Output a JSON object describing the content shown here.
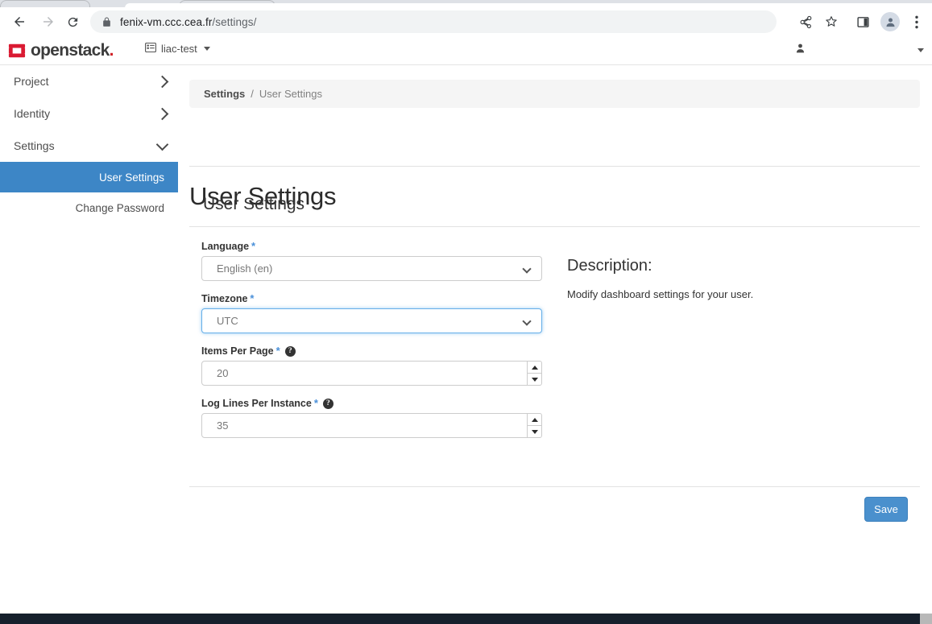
{
  "browser": {
    "url_domain": "fenix-vm.ccc.cea.fr",
    "url_path": "/settings/",
    "back_icon": "back-arrow-icon",
    "forward_icon": "forward-arrow-icon",
    "reload_icon": "reload-icon",
    "lock_icon": "lock-icon",
    "share_icon": "share-icon",
    "bookmark_icon": "star-icon",
    "sidepanel_icon": "side-panel-icon",
    "profile_icon": "profile-avatar-icon",
    "menu_icon": "three-dot-menu-icon"
  },
  "header": {
    "logo_text": "openstack",
    "logo_dot": ".",
    "project_name": "liac-test",
    "project_icon": "project-list-icon",
    "user_icon": "user-avatar-icon",
    "user_name": ""
  },
  "sidebar": {
    "groups": [
      {
        "label": "Project",
        "state": "collapsed",
        "icon": "chevron-right-icon"
      },
      {
        "label": "Identity",
        "state": "collapsed",
        "icon": "chevron-right-icon"
      },
      {
        "label": "Settings",
        "state": "expanded",
        "icon": "chevron-down-icon"
      }
    ],
    "items": [
      {
        "label": "User Settings",
        "active": true
      },
      {
        "label": "Change Password",
        "active": false
      }
    ]
  },
  "breadcrumb": {
    "parent": "Settings",
    "separator": "/",
    "current": "User Settings"
  },
  "page": {
    "title": "User Settings",
    "panel_title": "User Settings"
  },
  "form": {
    "fields": [
      {
        "label": "Language",
        "required_marker": "*",
        "type": "select",
        "value": "English (en)",
        "has_help": false,
        "focused": false,
        "caret_icon": "chevron-down-icon"
      },
      {
        "label": "Timezone",
        "required_marker": "*",
        "type": "select",
        "value": "UTC",
        "has_help": false,
        "focused": true,
        "caret_icon": "chevron-down-icon"
      },
      {
        "label": "Items Per Page",
        "required_marker": "*",
        "type": "number",
        "value": "20",
        "has_help": true,
        "help_icon": "help-circle-icon",
        "help_glyph": "?",
        "focused": false,
        "spinner_up_icon": "spinner-up-icon",
        "spinner_down_icon": "spinner-down-icon"
      },
      {
        "label": "Log Lines Per Instance",
        "required_marker": "*",
        "type": "number",
        "value": "35",
        "has_help": true,
        "help_icon": "help-circle-icon",
        "help_glyph": "?",
        "focused": false,
        "spinner_up_icon": "spinner-up-icon",
        "spinner_down_icon": "spinner-down-icon"
      }
    ]
  },
  "description": {
    "heading": "Description:",
    "body": "Modify dashboard settings for your user."
  },
  "actions": {
    "save_label": "Save"
  },
  "colors": {
    "accent_blue": "#4a90cd",
    "sidebar_active": "#3d86c6",
    "required_star": "#4a90d9",
    "logo_red": "#cf2127",
    "focus_ring": "#66afe9"
  }
}
